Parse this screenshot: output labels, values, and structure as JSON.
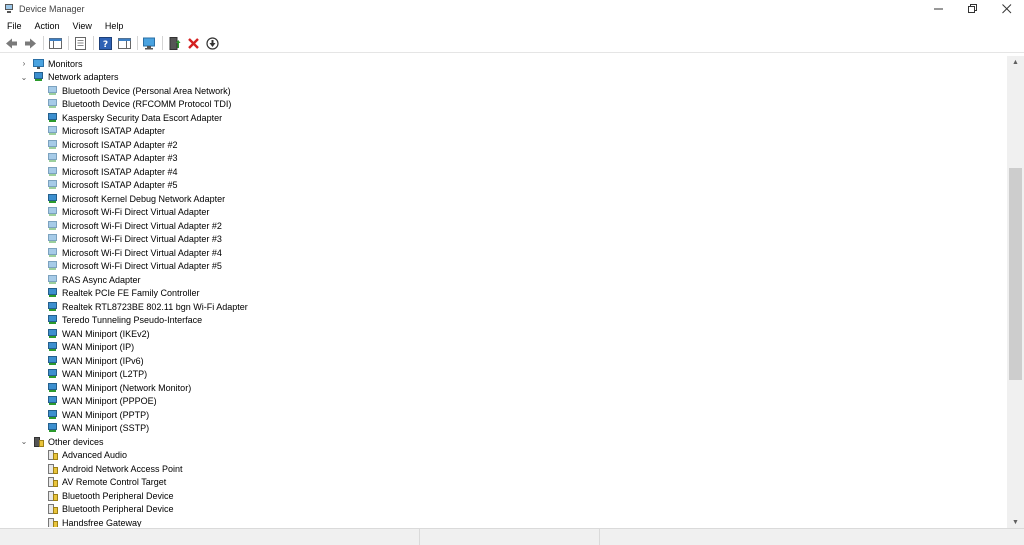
{
  "window": {
    "title": "Device Manager",
    "controls": [
      "minimize-icon",
      "restore-icon",
      "close-icon"
    ]
  },
  "menu": [
    "File",
    "Action",
    "View",
    "Help"
  ],
  "toolbar": {
    "buttons": [
      "back-arrow-icon",
      "forward-arrow-icon",
      "show-hide-console-tree-icon",
      "properties-icon",
      "help-icon",
      "action-pane-icon",
      "scan-hardware-icon",
      "update-driver-icon",
      "uninstall-device-icon",
      "disable-device-icon"
    ]
  },
  "tree": {
    "monitors": {
      "label": "Monitors",
      "expanded": false
    },
    "network_adapters": {
      "label": "Network adapters",
      "expanded": true,
      "items": [
        "Bluetooth Device (Personal Area Network)",
        "Bluetooth Device (RFCOMM Protocol TDI)",
        "Kaspersky Security Data Escort Adapter",
        "Microsoft ISATAP Adapter",
        "Microsoft ISATAP Adapter #2",
        "Microsoft ISATAP Adapter #3",
        "Microsoft ISATAP Adapter #4",
        "Microsoft ISATAP Adapter #5",
        "Microsoft Kernel Debug Network Adapter",
        "Microsoft Wi-Fi Direct Virtual Adapter",
        "Microsoft Wi-Fi Direct Virtual Adapter #2",
        "Microsoft Wi-Fi Direct Virtual Adapter #3",
        "Microsoft Wi-Fi Direct Virtual Adapter #4",
        "Microsoft Wi-Fi Direct Virtual Adapter #5",
        "RAS Async Adapter",
        "Realtek PCIe FE Family Controller",
        "Realtek RTL8723BE 802.11 bgn Wi-Fi Adapter",
        "Teredo Tunneling Pseudo-Interface",
        "WAN Miniport (IKEv2)",
        "WAN Miniport (IP)",
        "WAN Miniport (IPv6)",
        "WAN Miniport (L2TP)",
        "WAN Miniport (Network Monitor)",
        "WAN Miniport (PPPOE)",
        "WAN Miniport (PPTP)",
        "WAN Miniport (SSTP)"
      ],
      "dimmed_items": [
        0,
        1,
        3,
        4,
        5,
        6,
        7,
        9,
        10,
        11,
        12,
        13,
        14
      ]
    },
    "other_devices": {
      "label": "Other devices",
      "expanded": true,
      "items": [
        "Advanced Audio",
        "Android Network Access Point",
        "AV Remote Control Target",
        "Bluetooth Peripheral Device",
        "Bluetooth Peripheral Device",
        "Handsfree Gateway"
      ]
    }
  },
  "colors": {
    "adapter_icon": "#3c8fcf",
    "adapter_icon_dim": "#a6cbe8",
    "warning_badge": "#e9c43b",
    "scroll_thumb": "#cdcdcd"
  }
}
